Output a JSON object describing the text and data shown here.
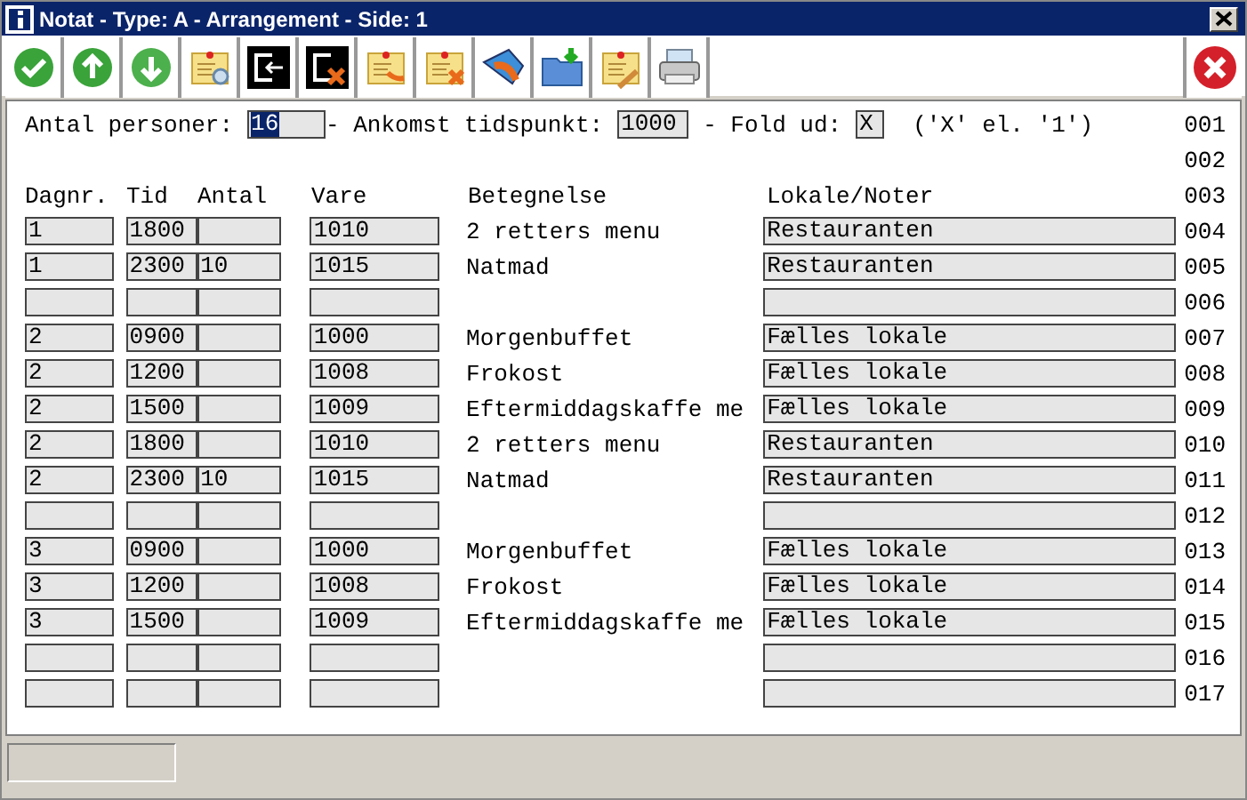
{
  "window": {
    "title": "Notat - Type: A - Arrangement - Side: 1"
  },
  "toolbar": [
    {
      "kind": "ok"
    },
    {
      "kind": "up"
    },
    {
      "kind": "down"
    },
    {
      "kind": "note-search"
    },
    {
      "kind": "exit"
    },
    {
      "kind": "exit-x"
    },
    {
      "kind": "note-arrow"
    },
    {
      "kind": "note-x"
    },
    {
      "kind": "send"
    },
    {
      "kind": "folder"
    },
    {
      "kind": "note-pen"
    },
    {
      "kind": "print"
    }
  ],
  "form": {
    "line": "001",
    "persons": {
      "label": "Antal personer:",
      "value": "16",
      "text_selected": true
    },
    "arrival": {
      "label": "- Ankomst tidspunkt:",
      "value": "1000"
    },
    "fold": {
      "label": "- Fold ud:",
      "value": "X",
      "hint": "('X' el. '1')"
    }
  },
  "blank_line": "002",
  "columns": {
    "line": "003",
    "dagnr": "Dagnr.",
    "tid": "Tid",
    "antal": "Antal",
    "vare": "Vare",
    "betegnelse": "Betegnelse",
    "lokale": "Lokale/Noter"
  },
  "rows": [
    {
      "line": "004",
      "dagnr": "1",
      "tid": "1800",
      "vare": "1010",
      "betegnelse": "2 retters menu",
      "lokale": "Restauranten"
    },
    {
      "line": "005",
      "dagnr": "1",
      "tid": "2300",
      "antal": "10",
      "vare": "1015",
      "betegnelse": "Natmad",
      "lokale": "Restauranten"
    },
    {
      "line": "006"
    },
    {
      "line": "007",
      "dagnr": "2",
      "tid": "0900",
      "vare": "1000",
      "betegnelse": "Morgenbuffet",
      "lokale": "Fælles lokale"
    },
    {
      "line": "008",
      "dagnr": "2",
      "tid": "1200",
      "vare": "1008",
      "betegnelse": "Frokost",
      "lokale": "Fælles lokale"
    },
    {
      "line": "009",
      "dagnr": "2",
      "tid": "1500",
      "vare": "1009",
      "betegnelse": "Eftermiddagskaffe me",
      "lokale": "Fælles lokale"
    },
    {
      "line": "010",
      "dagnr": "2",
      "tid": "1800",
      "vare": "1010",
      "betegnelse": "2 retters menu",
      "lokale": "Restauranten"
    },
    {
      "line": "011",
      "dagnr": "2",
      "tid": "2300",
      "antal": "10",
      "vare": "1015",
      "betegnelse": "Natmad",
      "lokale": "Restauranten"
    },
    {
      "line": "012"
    },
    {
      "line": "013",
      "dagnr": "3",
      "tid": "0900",
      "vare": "1000",
      "betegnelse": "Morgenbuffet",
      "lokale": "Fælles lokale"
    },
    {
      "line": "014",
      "dagnr": "3",
      "tid": "1200",
      "vare": "1008",
      "betegnelse": "Frokost",
      "lokale": "Fælles lokale"
    },
    {
      "line": "015",
      "dagnr": "3",
      "tid": "1500",
      "vare": "1009",
      "betegnelse": "Eftermiddagskaffe me",
      "lokale": "Fælles lokale"
    },
    {
      "line": "016"
    },
    {
      "line": "017"
    }
  ]
}
